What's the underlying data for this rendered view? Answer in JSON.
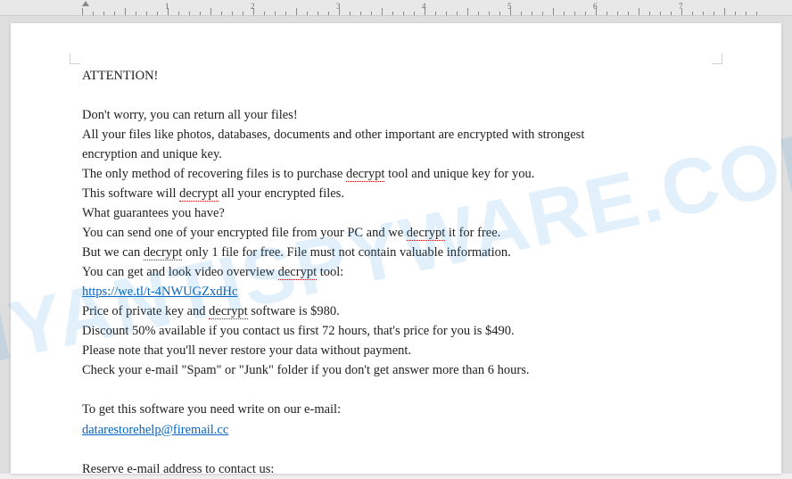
{
  "ruler": {
    "marks": [
      "1",
      "2",
      "3",
      "4",
      "5",
      "6",
      "7"
    ]
  },
  "watermark": "MYANTISPYWARE.COM",
  "doc": {
    "attention": "ATTENTION!",
    "line1": "Don't worry, you can return all your files!",
    "line2a": "All your files like photos, databases, documents and other important are encrypted with strongest",
    "line2b": "encryption and unique key.",
    "line3a": "The only method of recovering files is to purchase ",
    "line3b": " tool and unique key for you.",
    "line4a": "This software will ",
    "line4b": " all your encrypted files.",
    "line5": "What guarantees you have?",
    "line6a": "You can send one of your encrypted file from your PC and we ",
    "line6b": " it for free.",
    "line7a": "But we can ",
    "line7b": " only 1 file for free. File must not contain valuable information.",
    "line8a": "You can get and look video overview ",
    "line8b": " tool:",
    "link": "https://we.tl/t-4NWUGZxdHc",
    "line10a": "Price of private key and ",
    "line10b": " software is $980.",
    "line11": "Discount 50% available if you contact us first 72 hours, that's price for you is $490.",
    "line12": "Please note that you'll never restore your data without payment.",
    "line13": "Check your e-mail \"Spam\" or \"Junk\" folder if you don't get answer more than 6 hours.",
    "line14": "To get this software you need write on our e-mail:",
    "email1": "datarestorehelp@firemail.cc",
    "line16": "Reserve e-mail address to contact us:",
    "decrypt": "decrypt"
  }
}
